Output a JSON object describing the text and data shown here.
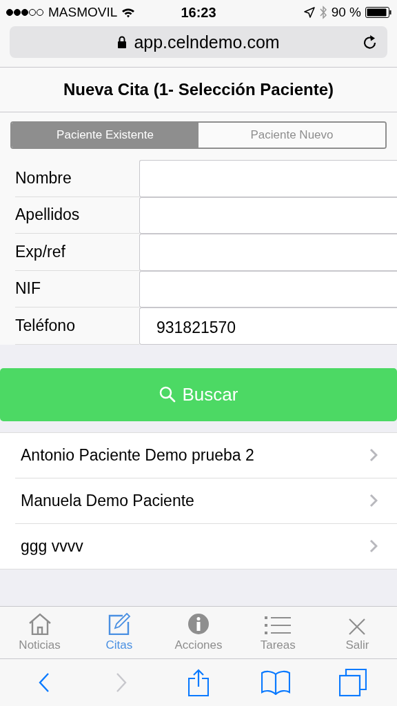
{
  "status_bar": {
    "carrier": "MASMOVIL",
    "time": "16:23",
    "battery": "90 %"
  },
  "url_bar": {
    "url": "app.celndemo.com"
  },
  "title": "Nueva Cita (1- Selección Paciente)",
  "segments": [
    {
      "label": "Paciente Existente",
      "selected": true
    },
    {
      "label": "Paciente Nuevo",
      "selected": false
    }
  ],
  "fields": [
    {
      "label": "Nombre"
    },
    {
      "label": "Apellidos"
    },
    {
      "label": "Exp/ref"
    },
    {
      "label": "NIF"
    },
    {
      "label": "Teléfono",
      "value": "931821570"
    }
  ],
  "search_button": {
    "label": "Buscar"
  },
  "results": [
    {
      "name": "Antonio Paciente Demo prueba 2"
    },
    {
      "name": "Manuela Demo Paciente"
    },
    {
      "name": "ggg vvvv"
    }
  ],
  "tab_bar": [
    {
      "kind": "home",
      "label": "Noticias",
      "selected": false
    },
    {
      "kind": "edit",
      "label": "Citas",
      "selected": true
    },
    {
      "kind": "info",
      "label": "Acciones",
      "selected": false
    },
    {
      "kind": "list",
      "label": "Tareas",
      "selected": false
    },
    {
      "kind": "close",
      "label": "Salir",
      "selected": false
    }
  ],
  "browser_toolbar": [
    {
      "kind": "back",
      "disabled": false
    },
    {
      "kind": "forward",
      "disabled": true
    },
    {
      "kind": "share",
      "disabled": false
    },
    {
      "kind": "bookmarks",
      "disabled": false
    },
    {
      "kind": "tabs",
      "disabled": false
    }
  ]
}
